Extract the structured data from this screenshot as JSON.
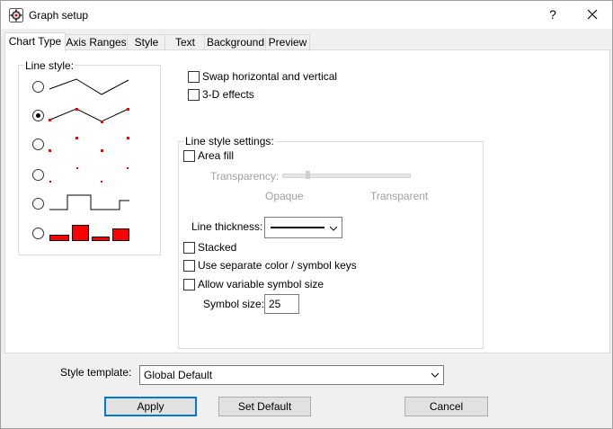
{
  "window": {
    "title": "Graph setup",
    "help_label": "?",
    "close_label": "✕"
  },
  "tabs": [
    {
      "label": "Chart Type",
      "active": true
    },
    {
      "label": "Axis Ranges",
      "active": false
    },
    {
      "label": "Style",
      "active": false
    },
    {
      "label": "Text",
      "active": false
    },
    {
      "label": "Background",
      "active": false
    },
    {
      "label": "Preview",
      "active": false
    }
  ],
  "line_style": {
    "label": "Line style:",
    "selected_index": 1,
    "options": [
      "line",
      "line-with-symbols",
      "symbols-sparse",
      "points",
      "step",
      "bars"
    ]
  },
  "options": {
    "swap_label": "Swap horizontal and vertical",
    "swap_checked": false,
    "effects_label": "3-D effects",
    "effects_checked": false
  },
  "settings": {
    "label": "Line style settings:",
    "area_fill_label": "Area fill",
    "area_fill_checked": false,
    "transparency_label": "Transparency:",
    "transparency_min_label": "Opaque",
    "transparency_max_label": "Transparent",
    "thickness_label": "Line thickness:",
    "stacked_label": "Stacked",
    "stacked_checked": false,
    "separate_keys_label": "Use separate color / symbol keys",
    "separate_keys_checked": false,
    "variable_size_label": "Allow variable symbol size",
    "variable_size_checked": false,
    "symbol_size_label": "Symbol size:",
    "symbol_size_value": "25"
  },
  "template": {
    "label": "Style template:",
    "value": "Global Default"
  },
  "buttons": {
    "apply": "Apply",
    "set_default": "Set Default",
    "cancel": "Cancel"
  },
  "colors": {
    "accent": "#0078d7",
    "symbol_red": "#ff0000"
  }
}
